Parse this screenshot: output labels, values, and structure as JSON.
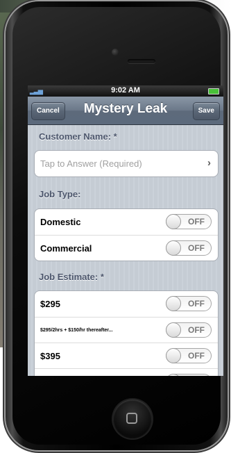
{
  "statusbar": {
    "time": "9:02 AM"
  },
  "navbar": {
    "cancel_label": "Cancel",
    "title": "Mystery Leak",
    "save_label": "Save"
  },
  "sections": {
    "customer_name": {
      "label": "Customer Name: *",
      "placeholder": "Tap to Answer (Required)"
    },
    "job_type": {
      "label": "Job Type:",
      "options": [
        {
          "label": "Domestic",
          "state": "OFF"
        },
        {
          "label": "Commercial",
          "state": "OFF"
        }
      ]
    },
    "job_estimate": {
      "label": "Job Estimate: *",
      "options": [
        {
          "label": "$295",
          "state": "OFF"
        },
        {
          "label": "$295/2hrs + $150/hr thereafter...",
          "state": "OFF"
        },
        {
          "label": "$395",
          "state": "OFF"
        }
      ]
    }
  },
  "icons": {
    "signal": "signal-icon",
    "battery": "battery-icon",
    "chevron": "chevron-right-icon",
    "home": "home-button-icon"
  },
  "colors": {
    "navbar": "#6b7889",
    "background": "#c5ccd4",
    "section_label": "#4c566c"
  }
}
